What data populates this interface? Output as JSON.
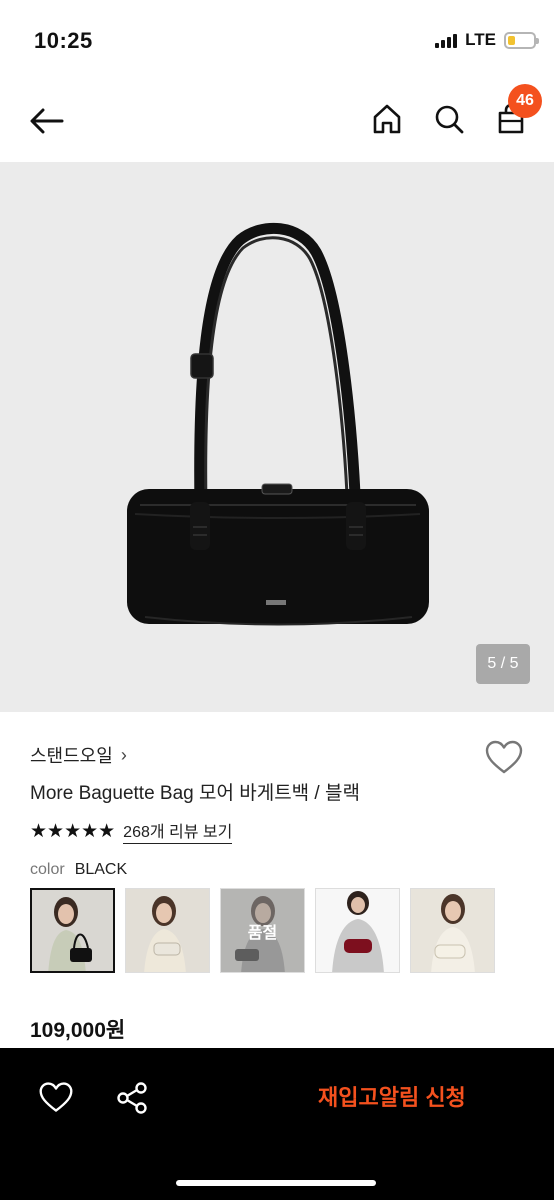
{
  "status_bar": {
    "time": "10:25",
    "network": "LTE",
    "battery_level": 0.28
  },
  "nav": {
    "cart_count": "46"
  },
  "hero": {
    "page_indicator": "5 / 5"
  },
  "product": {
    "brand": "스탠드오일",
    "brand_chevron": "›",
    "title": "More Baguette Bag 모어 바게트백 / 블랙",
    "rating_stars": "★★★★★",
    "review_link": "268개 리뷰 보기",
    "color_label": "color",
    "color_value": "BLACK",
    "swatches": [
      {
        "name": "black",
        "selected": true
      },
      {
        "name": "ivory",
        "selected": false
      },
      {
        "name": "gray",
        "selected": false,
        "badge": "품절"
      },
      {
        "name": "burgundy",
        "selected": false
      },
      {
        "name": "cream",
        "selected": false
      }
    ],
    "price": "109,000원"
  },
  "bottom_bar": {
    "restock_label": "재입고알림 신청"
  },
  "colors": {
    "accent": "#f4511e",
    "hero_bg": "#ebebeb",
    "bottom_bg": "#000000"
  },
  "icons": [
    "back-arrow-icon",
    "home-icon",
    "search-icon",
    "shopping-bag-icon",
    "heart-icon",
    "share-icon"
  ]
}
